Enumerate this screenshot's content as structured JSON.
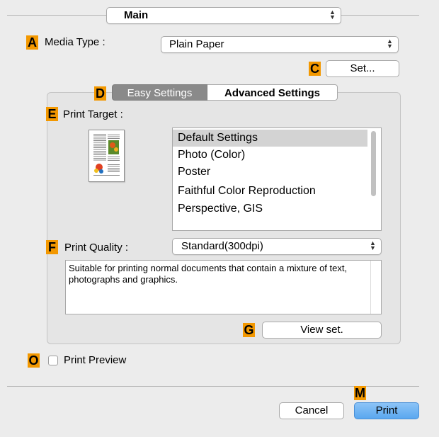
{
  "panel_select": {
    "value": "Main"
  },
  "media_type": {
    "callout": "A",
    "label": "Media Type :",
    "value": "Plain Paper"
  },
  "set_button": {
    "callout": "C",
    "label": "Set..."
  },
  "tabs": {
    "callout": "D",
    "items": [
      {
        "label": "Easy Settings",
        "selected": true
      },
      {
        "label": "Advanced Settings",
        "selected": false
      }
    ]
  },
  "print_target": {
    "callout": "E",
    "label": "Print Target :",
    "options": [
      "Default Settings",
      "Photo (Color)",
      "Poster",
      "Faithful Color Reproduction",
      "Perspective, GIS"
    ],
    "selected_index": 0
  },
  "print_quality": {
    "callout": "F",
    "label": "Print Quality :",
    "value": "Standard(300dpi)",
    "description": "Suitable for printing normal documents that contain a mixture of text, photographs and graphics."
  },
  "view_settings": {
    "callout": "G",
    "label": "View set."
  },
  "print_preview": {
    "callout": "O",
    "label": "Print Preview",
    "checked": false
  },
  "footer": {
    "cancel_label": "Cancel",
    "print_callout": "M",
    "print_label": "Print"
  },
  "colors": {
    "callout": "#f39800",
    "tab_selected": "#8a8a8a",
    "default_button": "#6db3f2"
  }
}
